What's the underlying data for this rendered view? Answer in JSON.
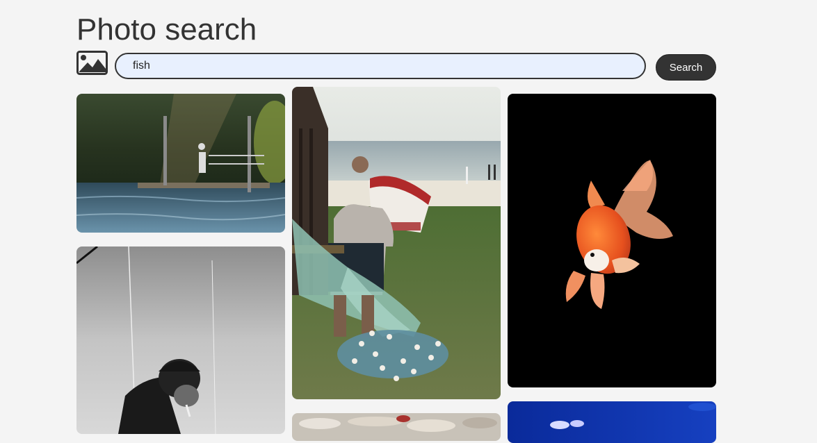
{
  "header": {
    "title": "Photo search"
  },
  "search": {
    "value": "fish",
    "button_label": "Search"
  },
  "results": [
    {
      "subject": "fisherman on pier over lake"
    },
    {
      "subject": "black and white fisherman smoking"
    },
    {
      "subject": "fisherman with net near boat on beach"
    },
    {
      "subject": "fish market"
    },
    {
      "subject": "goldfish on black background"
    },
    {
      "subject": "blue underwater scene"
    }
  ]
}
